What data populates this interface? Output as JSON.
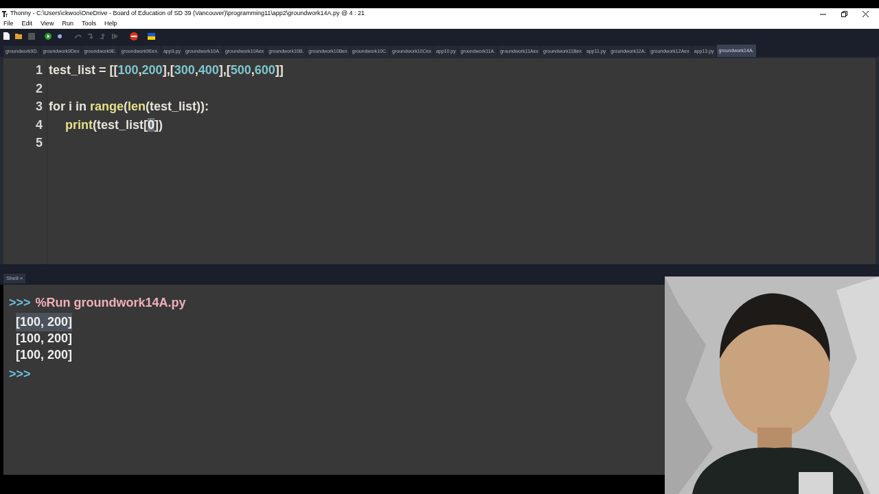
{
  "window": {
    "title": "Thonny  -  C:\\Users\\ckwoo\\OneDrive - Board of Education of SD 39 (Vancouver)\\programming11\\app2\\groundwork14A.py  @  4 : 21"
  },
  "menu": [
    "File",
    "Edit",
    "View",
    "Run",
    "Tools",
    "Help"
  ],
  "tabs": [
    {
      "label": "groundwork9D.",
      "selected": false
    },
    {
      "label": "groundwork9Dex",
      "selected": false
    },
    {
      "label": "groundwork9E.",
      "selected": false
    },
    {
      "label": "groundwork9Eex.",
      "selected": false
    },
    {
      "label": "app9.py",
      "selected": false
    },
    {
      "label": "groundwork10A.",
      "selected": false
    },
    {
      "label": "groundwork10Aex",
      "selected": false
    },
    {
      "label": "groundwork10B.",
      "selected": false
    },
    {
      "label": "groundwork10Bex",
      "selected": false
    },
    {
      "label": "groundwork10C.",
      "selected": false
    },
    {
      "label": "groundwork10Cex",
      "selected": false
    },
    {
      "label": "app10.py",
      "selected": false
    },
    {
      "label": "groundwork11A.",
      "selected": false
    },
    {
      "label": "groundwork11Aex",
      "selected": false
    },
    {
      "label": "groundwork11Bex",
      "selected": false
    },
    {
      "label": "app11.py",
      "selected": false
    },
    {
      "label": "groundwork12A.",
      "selected": false
    },
    {
      "label": "groundwork12Aex",
      "selected": false
    },
    {
      "label": "app13.py",
      "selected": false
    },
    {
      "label": "groundwork14A.",
      "selected": true
    }
  ],
  "editor": {
    "lines": [
      {
        "number": "1",
        "tokens": [
          {
            "kind": "plain",
            "text": "test_list = [["
          },
          {
            "kind": "number",
            "text": "100"
          },
          {
            "kind": "plain",
            "text": ","
          },
          {
            "kind": "number",
            "text": "200"
          },
          {
            "kind": "plain",
            "text": "],["
          },
          {
            "kind": "number",
            "text": "300"
          },
          {
            "kind": "plain",
            "text": ","
          },
          {
            "kind": "number",
            "text": "400"
          },
          {
            "kind": "plain",
            "text": "],["
          },
          {
            "kind": "number",
            "text": "500"
          },
          {
            "kind": "plain",
            "text": ","
          },
          {
            "kind": "number",
            "text": "600"
          },
          {
            "kind": "plain",
            "text": "]]"
          }
        ]
      },
      {
        "number": "2"
      },
      {
        "number": "3",
        "tokens": [
          {
            "kind": "plain",
            "text": "for i in "
          },
          {
            "kind": "builtin",
            "text": "range"
          },
          {
            "kind": "plain",
            "text": "("
          },
          {
            "kind": "builtin",
            "text": "len"
          },
          {
            "kind": "plain",
            "text": "(test_list)):"
          }
        ]
      },
      {
        "number": "4",
        "indented": true,
        "tokens": [
          {
            "kind": "builtin",
            "text": "print"
          },
          {
            "kind": "plain",
            "text": "(test_list["
          },
          {
            "kind": "match",
            "text": "0"
          },
          {
            "kind": "plain",
            "text": "])"
          }
        ]
      },
      {
        "number": "5"
      }
    ]
  },
  "shell": {
    "tab": "Shell",
    "close": "×",
    "entries": [
      {
        "kind": "command",
        "prompt": ">>>",
        "text": "%Run groundwork14A.py"
      },
      {
        "kind": "output",
        "text": "[100, 200]",
        "selected": true
      },
      {
        "kind": "output",
        "text": "[100, 200]",
        "selected": false
      },
      {
        "kind": "output",
        "text": "[100, 200]",
        "selected": false
      },
      {
        "kind": "prompt",
        "prompt": ">>>"
      }
    ]
  }
}
